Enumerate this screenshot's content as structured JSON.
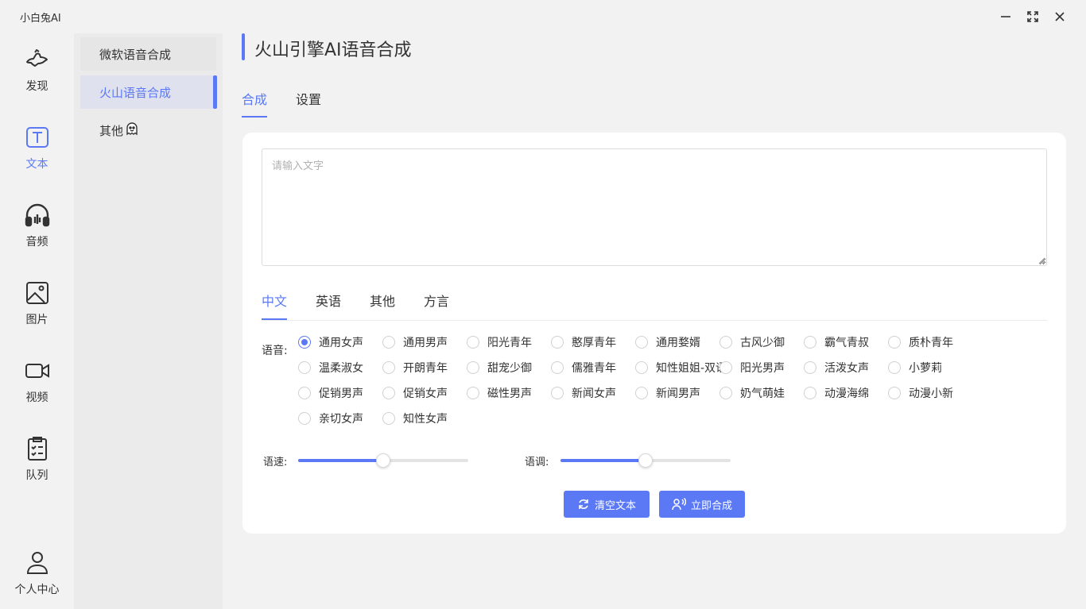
{
  "app": {
    "title": "小白兔AI"
  },
  "window_controls": {
    "minimize_icon": "minimize-icon",
    "maximize_icon": "maximize-icon",
    "close_icon": "close-icon"
  },
  "leftnav": {
    "items": [
      {
        "label": "发现",
        "icon": "discover-icon"
      },
      {
        "label": "文本",
        "icon": "text-icon",
        "active": true
      },
      {
        "label": "音频",
        "icon": "headphones-icon"
      },
      {
        "label": "图片",
        "icon": "image-icon"
      },
      {
        "label": "视频",
        "icon": "video-icon"
      },
      {
        "label": "队列",
        "icon": "queue-icon"
      }
    ],
    "profile": {
      "label": "个人中心",
      "icon": "user-icon"
    }
  },
  "subnav": {
    "items": [
      {
        "label": "微软语音合成"
      },
      {
        "label": "火山语音合成",
        "active": true
      },
      {
        "label": "其他"
      }
    ]
  },
  "page": {
    "title": "火山引擎AI语音合成"
  },
  "tabs": [
    {
      "label": "合成",
      "active": true
    },
    {
      "label": "设置"
    }
  ],
  "editor": {
    "placeholder": "请输入文字"
  },
  "lang_tabs": [
    {
      "label": "中文",
      "active": true
    },
    {
      "label": "英语"
    },
    {
      "label": "其他"
    },
    {
      "label": "方言"
    }
  ],
  "voices": {
    "label": "语音:",
    "selected": "通用女声",
    "options": [
      "通用女声",
      "通用男声",
      "阳光青年",
      "憨厚青年",
      "通用婺婿",
      "古风少御",
      "霸气青叔",
      "质朴青年",
      "温柔淑女",
      "开朗青年",
      "甜宠少御",
      "儒雅青年",
      "知性姐姐-双语",
      "阳光男声",
      "活泼女声",
      "小萝莉",
      "促销男声",
      "促销女声",
      "磁性男声",
      "新闻女声",
      "新闻男声",
      "奶气萌娃",
      "动漫海绵",
      "动漫小新",
      "亲切女声",
      "知性女声"
    ]
  },
  "speed": {
    "label": "语速:",
    "value": 0.5
  },
  "pitch": {
    "label": "语调:",
    "value": 0.5
  },
  "actions": {
    "clear": {
      "label": "清空文本",
      "icon": "refresh-icon"
    },
    "synthesize": {
      "label": "立即合成",
      "icon": "speaker-person-icon"
    }
  },
  "colors": {
    "accent": "#5b79f5",
    "sidebar": "#ebebeb",
    "background": "#f2f2f2"
  }
}
